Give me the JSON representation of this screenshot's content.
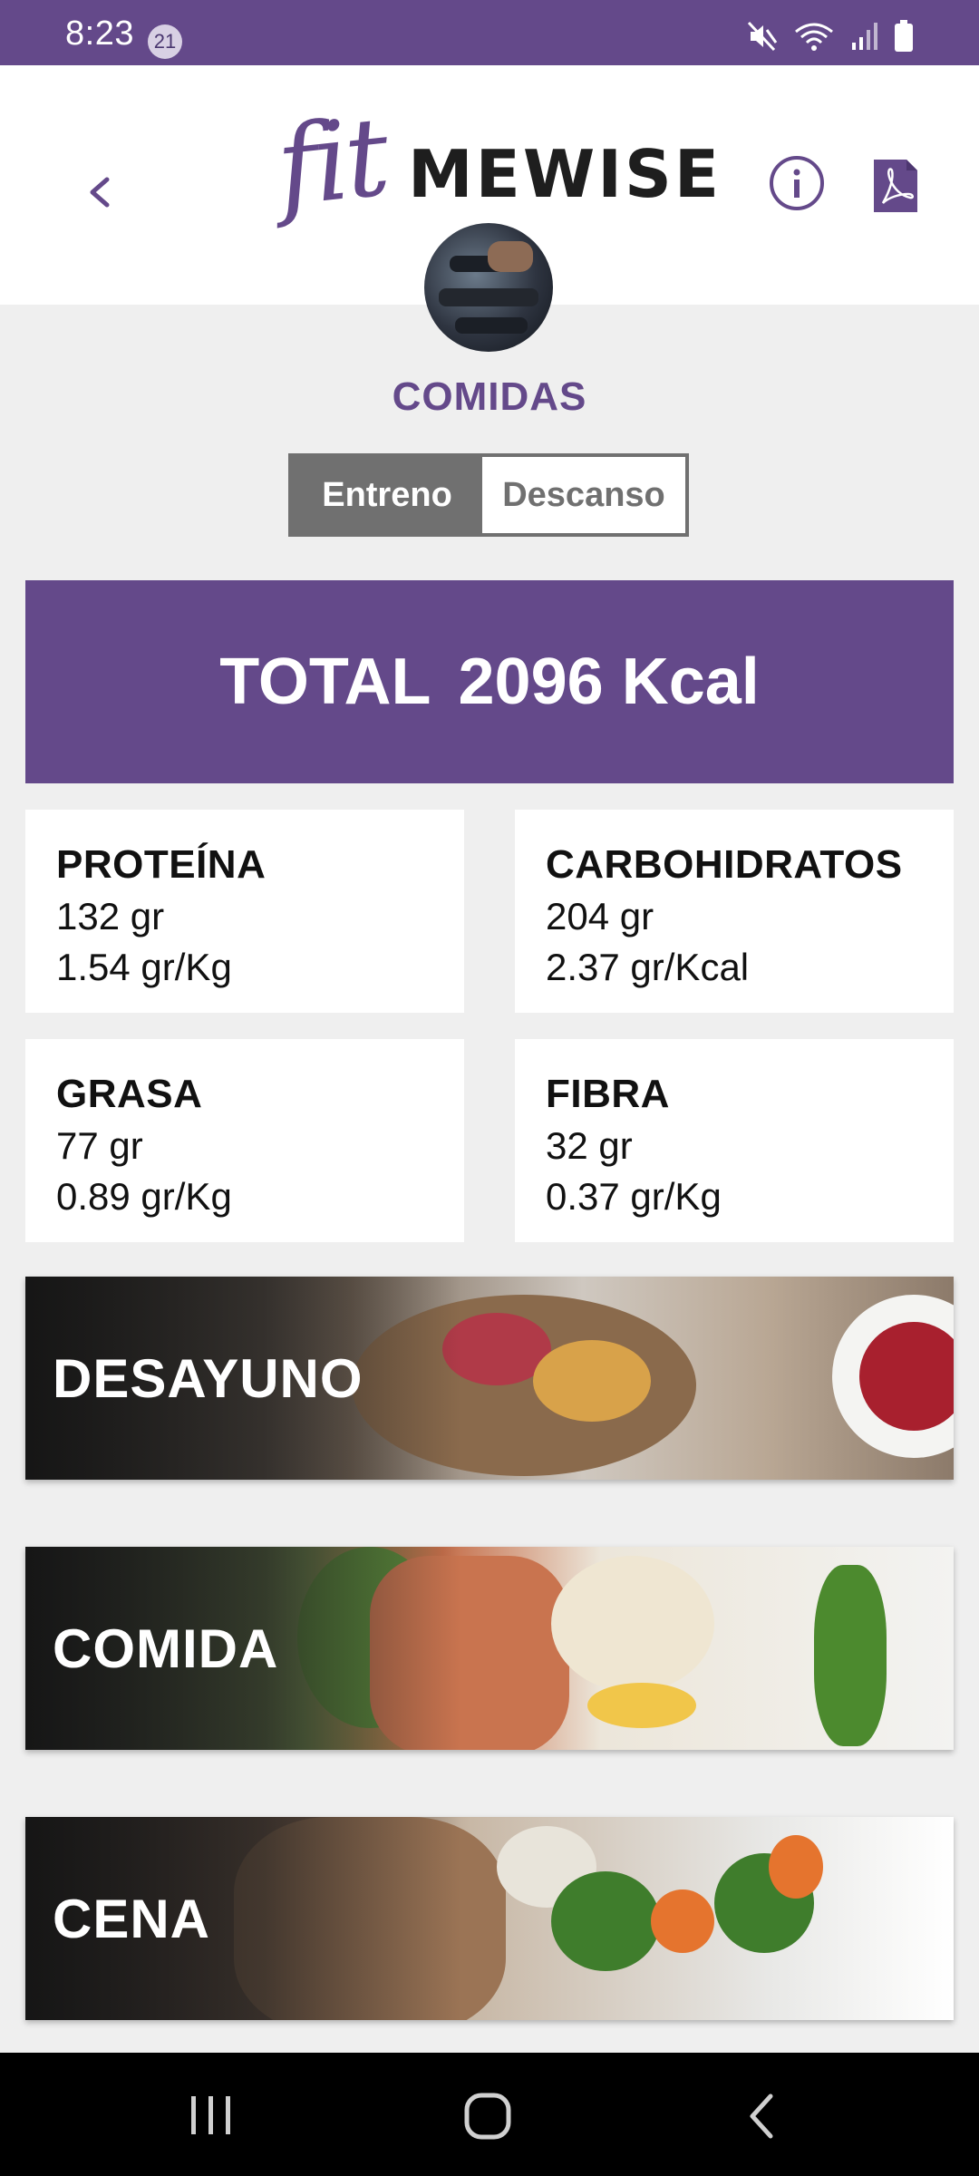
{
  "status_bar": {
    "time": "8:23",
    "notification_count": "21",
    "icons": [
      "mute-icon",
      "wifi-icon",
      "signal-icon",
      "battery-icon"
    ]
  },
  "header": {
    "logo_script": "fit",
    "logo_word": "MEWISE",
    "back_icon": "chevron-left-icon",
    "info_icon": "info-icon",
    "pdf_icon": "pdf-icon"
  },
  "page": {
    "title": "COMIDAS"
  },
  "toggle": {
    "options": [
      "Entreno",
      "Descanso"
    ],
    "selected": "Entreno"
  },
  "total": {
    "label": "TOTAL",
    "value": "2096 Kcal"
  },
  "macros": [
    {
      "name": "PROTEÍNA",
      "amount": "132 gr",
      "ratio": "1.54 gr/Kg"
    },
    {
      "name": "CARBOHIDRATOS",
      "amount": "204 gr",
      "ratio": "2.37 gr/Kcal"
    },
    {
      "name": "GRASA",
      "amount": "77 gr",
      "ratio": "0.89 gr/Kg"
    },
    {
      "name": "FIBRA",
      "amount": "32 gr",
      "ratio": "0.37 gr/Kg"
    }
  ],
  "meals": [
    "DESAYUNO",
    "COMIDA",
    "CENA"
  ],
  "colors": {
    "brand": "#64498a",
    "toggle_active": "#707070",
    "background": "#efefef"
  },
  "nav_bar": {
    "icons": [
      "recent-apps-icon",
      "home-icon",
      "back-icon"
    ]
  }
}
